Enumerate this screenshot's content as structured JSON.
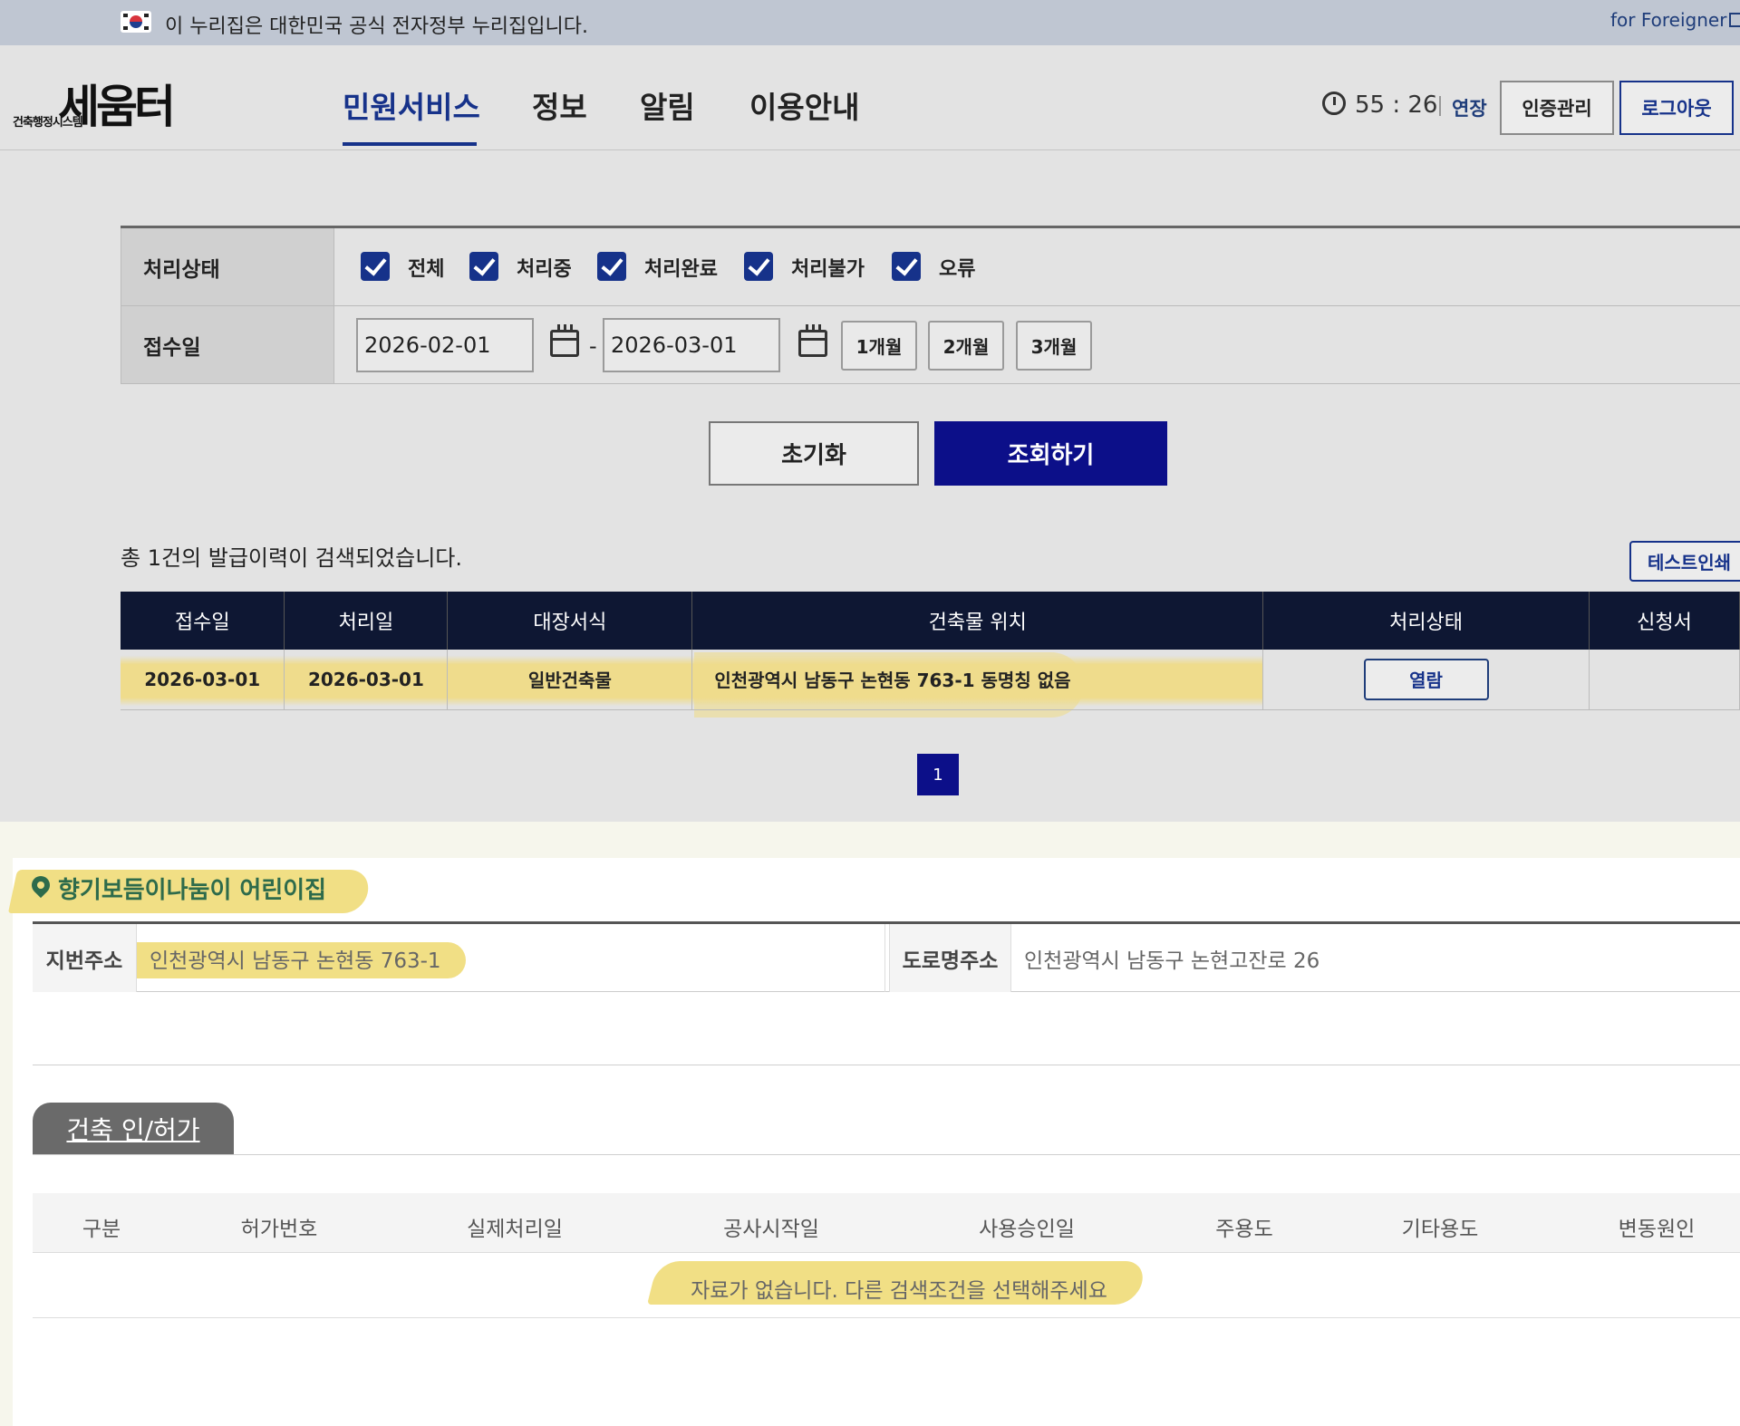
{
  "gov_banner": {
    "text": "이 누리집은 대한민국 공식 전자정부 누리집입니다.",
    "foreigner_link": "for Foreigner"
  },
  "logo": {
    "main": "세움터",
    "sub": "건축행정시스템"
  },
  "nav": {
    "items": [
      {
        "label": "민원서비스",
        "active": true
      },
      {
        "label": "정보",
        "active": false
      },
      {
        "label": "알림",
        "active": false
      },
      {
        "label": "이용안내",
        "active": false
      }
    ]
  },
  "session": {
    "timer": "55 : 26",
    "extend_label": "연장",
    "cert_button": "인증관리",
    "logout_button": "로그아웃"
  },
  "search_form": {
    "status_label": "처리상태",
    "status_options": [
      {
        "label": "전체",
        "checked": true
      },
      {
        "label": "처리중",
        "checked": true
      },
      {
        "label": "처리완료",
        "checked": true
      },
      {
        "label": "처리불가",
        "checked": true
      },
      {
        "label": "오류",
        "checked": true
      }
    ],
    "date_label": "접수일",
    "date_from": "2026-02-01",
    "date_sep": "-",
    "date_to": "2026-03-01",
    "period_buttons": [
      "1개월",
      "2개월",
      "3개월"
    ],
    "reset_button": "초기화",
    "search_button": "조회하기"
  },
  "results": {
    "count_text": "총 1건의 발급이력이 검색되었습니다.",
    "test_print_button": "테스트인쇄",
    "columns": [
      "접수일",
      "처리일",
      "대장서식",
      "건축물 위치",
      "처리상태",
      "신청서"
    ],
    "rows": [
      {
        "received": "2026-03-01",
        "processed": "2026-03-01",
        "form": "일반건축물",
        "location": "인천광역시 남동구 논현동 763-1 동명칭 없음",
        "status_button": "열람",
        "application": ""
      }
    ],
    "pagination": {
      "current": "1"
    }
  },
  "building": {
    "name": "향기보듬이나눔이 어린이집",
    "jibun_label": "지번주소",
    "jibun_value": "인천광역시 남동구 논현동 763-1",
    "road_label": "도로명주소",
    "road_value": "인천광역시 남동구 논현고잔로 26"
  },
  "permits": {
    "tab_label": "건축 인/허가",
    "columns": [
      "구분",
      "허가번호",
      "실제처리일",
      "공사시작일",
      "사용승인일",
      "주용도",
      "기타용도",
      "변동원인"
    ],
    "empty_message": "자료가 없습니다. 다른 검색조건을 선택해주세요"
  }
}
